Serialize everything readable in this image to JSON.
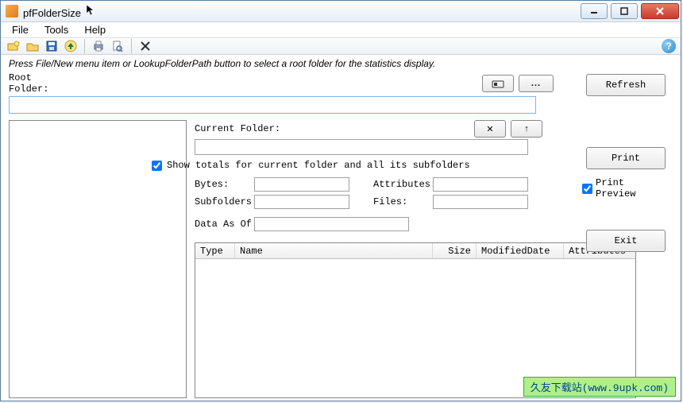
{
  "window": {
    "title": "pfFolderSize"
  },
  "menu": {
    "file": "File",
    "tools": "Tools",
    "help": "Help"
  },
  "toolbar_icons": {
    "new": "new-folder-icon",
    "open": "open-folder-icon",
    "save": "save-icon",
    "up": "up-arrow-icon",
    "print": "printer-icon",
    "preview": "preview-icon",
    "delete": "delete-icon"
  },
  "hint": "Press File/New menu item or LookupFolderPath button to select a root folder for the statistics display.",
  "root": {
    "label": "Root Folder:",
    "value": "",
    "lookup_glyph": "📇",
    "more_glyph": "...",
    "refresh": "Refresh"
  },
  "current": {
    "label": "Current Folder:",
    "value": "",
    "close_glyph": "✕",
    "up_glyph": "↑"
  },
  "totals": {
    "checked": true,
    "label": "Show totals for current folder and all its subfolders"
  },
  "stats": {
    "bytes_label": "Bytes:",
    "bytes": "",
    "subfolders_label": "Subfolders:",
    "subfolders": "",
    "attributes_label": "Attributes:",
    "attributes": "",
    "files_label": "Files:",
    "files": "",
    "dataasof_label": "Data As Of",
    "dataasof": ""
  },
  "grid": {
    "columns": {
      "type": "Type",
      "name": "Name",
      "size": "Size",
      "modified": "ModifiedDate",
      "attributes": "Attributes"
    },
    "rows": []
  },
  "actions": {
    "print": "Print",
    "print_preview_checked": true,
    "print_preview_label": "Print Preview",
    "exit": "Exit"
  },
  "watermark": {
    "text": "久友下载站(www.9upk.com)"
  }
}
